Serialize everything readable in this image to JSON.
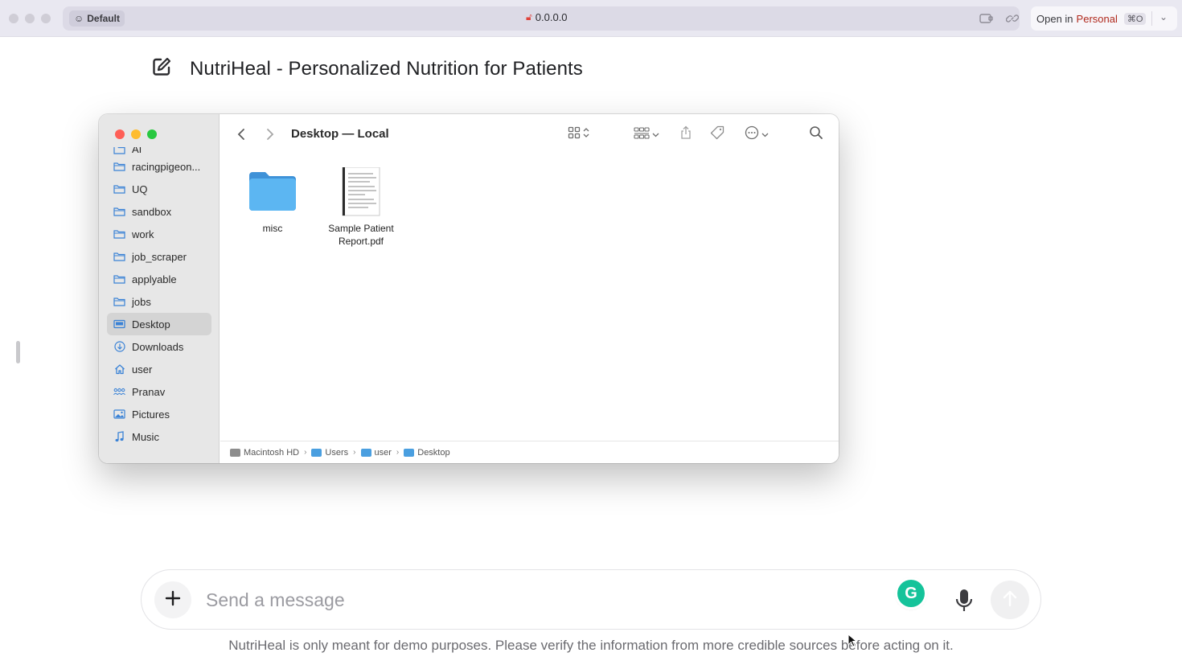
{
  "browser": {
    "profile_label": "Default",
    "url": "0.0.0.0",
    "open_in_prefix": "Open in",
    "open_in_target": "Personal",
    "open_in_shortcut": "⌘O"
  },
  "page": {
    "title": "NutriHeal - Personalized Nutrition for Patients"
  },
  "finder": {
    "window_title": "Desktop — Local",
    "sidebar_items": [
      {
        "label": "AI",
        "icon": "folder-icon"
      },
      {
        "label": "racingpigeon...",
        "icon": "folder-icon"
      },
      {
        "label": "UQ",
        "icon": "folder-icon"
      },
      {
        "label": "sandbox",
        "icon": "folder-icon"
      },
      {
        "label": "work",
        "icon": "folder-icon"
      },
      {
        "label": "job_scraper",
        "icon": "folder-icon"
      },
      {
        "label": "applyable",
        "icon": "folder-icon"
      },
      {
        "label": "jobs",
        "icon": "folder-icon"
      },
      {
        "label": "Desktop",
        "icon": "desktop-icon",
        "selected": true
      },
      {
        "label": "Downloads",
        "icon": "downloads-icon"
      },
      {
        "label": "user",
        "icon": "home-icon"
      },
      {
        "label": "Pranav",
        "icon": "people-icon"
      },
      {
        "label": "Pictures",
        "icon": "pictures-icon"
      },
      {
        "label": "Music",
        "icon": "music-icon"
      }
    ],
    "files": [
      {
        "name": "misc",
        "type": "folder"
      },
      {
        "name_line1": "Sample Patient",
        "name_line2": "Report.pdf",
        "type": "pdf"
      }
    ],
    "path": [
      "Macintosh HD",
      "Users",
      "user",
      "Desktop"
    ]
  },
  "composer": {
    "placeholder": "Send a message",
    "disclaimer": "NutriHeal is only meant for demo purposes. Please verify the information from more credible sources before acting on it."
  },
  "colors": {
    "accent_folder": "#4a9fe0",
    "grammarly": "#15c39a",
    "close": "#fe5f57",
    "minimize": "#febc2e",
    "zoom": "#28c840"
  }
}
